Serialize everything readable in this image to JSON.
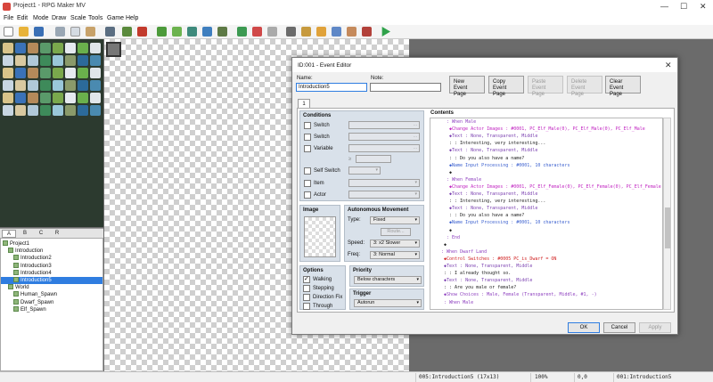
{
  "window": {
    "title": "Project1 - RPG Maker MV"
  },
  "menu": [
    "File",
    "Edit",
    "Mode",
    "Draw",
    "Scale",
    "Tools",
    "Game",
    "Help"
  ],
  "tabs": [
    "A",
    "B",
    "C",
    "R"
  ],
  "tree": [
    {
      "label": "Project1",
      "indent": 0
    },
    {
      "label": "Introduction",
      "indent": 1
    },
    {
      "label": "Introduction2",
      "indent": 2
    },
    {
      "label": "Introduction3",
      "indent": 2
    },
    {
      "label": "Introduction4",
      "indent": 2
    },
    {
      "label": "Introduction5",
      "indent": 2,
      "selected": true
    },
    {
      "label": "World",
      "indent": 1
    },
    {
      "label": "Human_Spawn",
      "indent": 2
    },
    {
      "label": "Dwarf_Spawn",
      "indent": 2
    },
    {
      "label": "Elf_Spawn",
      "indent": 2
    }
  ],
  "status": {
    "map": "005:Introduction5 (17x13)",
    "zoom": "100%",
    "coords": "0,0",
    "event": "001:Introduction5"
  },
  "dialog": {
    "title": "ID:001 - Event Editor",
    "name_label": "Name:",
    "name_value": "Introduction5",
    "note_label": "Note:",
    "note_value": "",
    "buttons": {
      "new": [
        "New",
        "Event Page"
      ],
      "copy": [
        "Copy",
        "Event Page"
      ],
      "paste": [
        "Paste",
        "Event Page"
      ],
      "delete": [
        "Delete",
        "Event Page"
      ],
      "clear": [
        "Clear",
        "Event Page"
      ]
    },
    "page_tab": "1",
    "conditions": {
      "heading": "Conditions",
      "switch1": "Switch",
      "switch2": "Switch",
      "variable": "Variable",
      "gte": "≥",
      "self_switch": "Self Switch",
      "item": "Item",
      "actor": "Actor",
      "ellipsis": "..."
    },
    "image": {
      "heading": "Image"
    },
    "autonomous": {
      "heading": "Autonomous Movement",
      "type_label": "Type:",
      "type_value": "Fixed",
      "route_button": "Route...",
      "speed_label": "Speed:",
      "speed_value": "3: x2 Slower",
      "freq_label": "Freq:",
      "freq_value": "3: Normal"
    },
    "options": {
      "heading": "Options",
      "walking": "Walking",
      "stepping": "Stepping",
      "direction_fix": "Direction Fix",
      "through": "Through"
    },
    "priority": {
      "heading": "Priority",
      "value": "Below characters"
    },
    "trigger": {
      "heading": "Trigger",
      "value": "Autorun"
    },
    "contents_heading": "Contents",
    "footer": {
      "ok": "OK",
      "cancel": "Cancel",
      "apply": "Apply"
    }
  },
  "contents_lines": [
    {
      "indent": 6,
      "text": ": When Male",
      "color": "#8d3fbf"
    },
    {
      "indent": 7,
      "text": "◆Change Actor Images : #0001, PC_Elf_Male(0), PC_Elf_Male(0), PC_Elf_Male",
      "color": "#c022c0"
    },
    {
      "indent": 7,
      "text": "◆Text : None, Transparent, Middle",
      "color": "#7a3fb0"
    },
    {
      "indent": 7,
      "text": "  :     : Interesting, very interesting...",
      "color": "#222222"
    },
    {
      "indent": 7,
      "text": "◆Text : None, Transparent, Middle",
      "color": "#7a3fb0"
    },
    {
      "indent": 7,
      "text": "  :     : Do you also have a name?",
      "color": "#222222"
    },
    {
      "indent": 7,
      "text": "◆Name Input Processing : #0001, 10 characters",
      "color": "#3a5fcf"
    },
    {
      "indent": 7,
      "text": "◆",
      "color": "#222222"
    },
    {
      "indent": 6,
      "text": ": When Female",
      "color": "#8d3fbf"
    },
    {
      "indent": 7,
      "text": "◆Change Actor Images : #0001, PC_Elf_Female(0), PC_Elf_Female(0), PC_Elf_Female",
      "color": "#c022c0"
    },
    {
      "indent": 7,
      "text": "◆Text : None, Transparent, Middle",
      "color": "#7a3fb0"
    },
    {
      "indent": 7,
      "text": "  :     : Interesting, very interesting...",
      "color": "#222222"
    },
    {
      "indent": 7,
      "text": "◆Text : None, Transparent, Middle",
      "color": "#7a3fb0"
    },
    {
      "indent": 7,
      "text": "  :     : Do you also have a name?",
      "color": "#222222"
    },
    {
      "indent": 7,
      "text": "◆Name Input Processing : #0001, 10 characters",
      "color": "#3a5fcf"
    },
    {
      "indent": 7,
      "text": "◆",
      "color": "#222222"
    },
    {
      "indent": 6,
      "text": ": End",
      "color": "#8d3fbf"
    },
    {
      "indent": 5,
      "text": "◆",
      "color": "#222222"
    },
    {
      "indent": 4,
      "text": ": When Dwarf Land",
      "color": "#8d3fbf"
    },
    {
      "indent": 5,
      "text": "◆Control Switches : #0005 PC_is_Dwarf = ON",
      "color": "#d02020"
    },
    {
      "indent": 5,
      "text": "◆Text : None, Transparent, Middle",
      "color": "#7a3fb0"
    },
    {
      "indent": 5,
      "text": "  :     : I already thought so.",
      "color": "#222222"
    },
    {
      "indent": 5,
      "text": "◆Text : None, Transparent, Middle",
      "color": "#7a3fb0"
    },
    {
      "indent": 5,
      "text": "  :     : Are you male or female?",
      "color": "#222222"
    },
    {
      "indent": 5,
      "text": "◆Show Choices : Male, Female (Transparent, Middle, #1, -)",
      "color": "#8d3fbf"
    },
    {
      "indent": 5,
      "text": ": When Male",
      "color": "#8d3fbf"
    }
  ]
}
